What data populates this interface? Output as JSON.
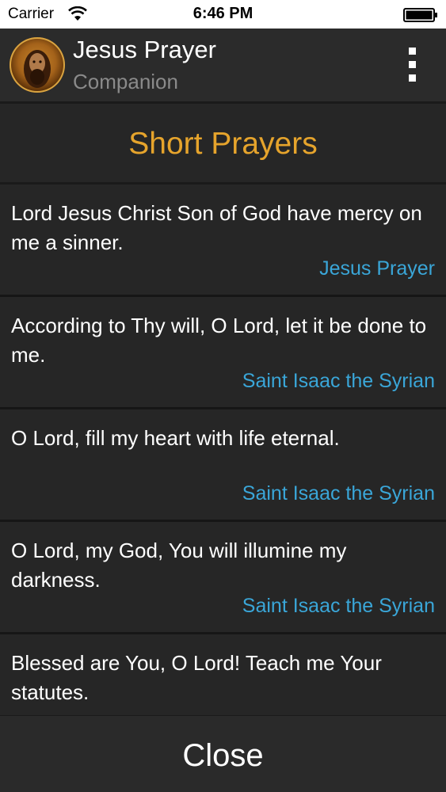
{
  "status_bar": {
    "carrier": "Carrier",
    "time": "6:46 PM",
    "wifi_icon": "wifi-icon",
    "battery_icon": "battery-icon"
  },
  "header": {
    "title": "Jesus Prayer",
    "subtitle": "Companion",
    "avatar_icon": "icon-avatar",
    "menu_icon": "more-vertical-icon"
  },
  "section": {
    "title": "Short Prayers"
  },
  "prayers": [
    {
      "text": "Lord Jesus Christ Son of God have mercy on me a sinner.",
      "source": "Jesus Prayer"
    },
    {
      "text": "According to Thy will, O Lord, let it be done to me.",
      "source": "Saint Isaac the Syrian"
    },
    {
      "text": "O Lord, fill my heart with life eternal.",
      "source": "Saint Isaac the Syrian"
    },
    {
      "text": "O Lord, my God, You will illumine my darkness.",
      "source": "Saint Isaac the Syrian"
    },
    {
      "text": "Blessed are You, O Lord! Teach me Your statutes.",
      "source": ""
    }
  ],
  "footer": {
    "close_label": "Close"
  },
  "colors": {
    "background": "#252525",
    "title_accent": "#e6a42c",
    "source_link": "#3aa6d8"
  }
}
